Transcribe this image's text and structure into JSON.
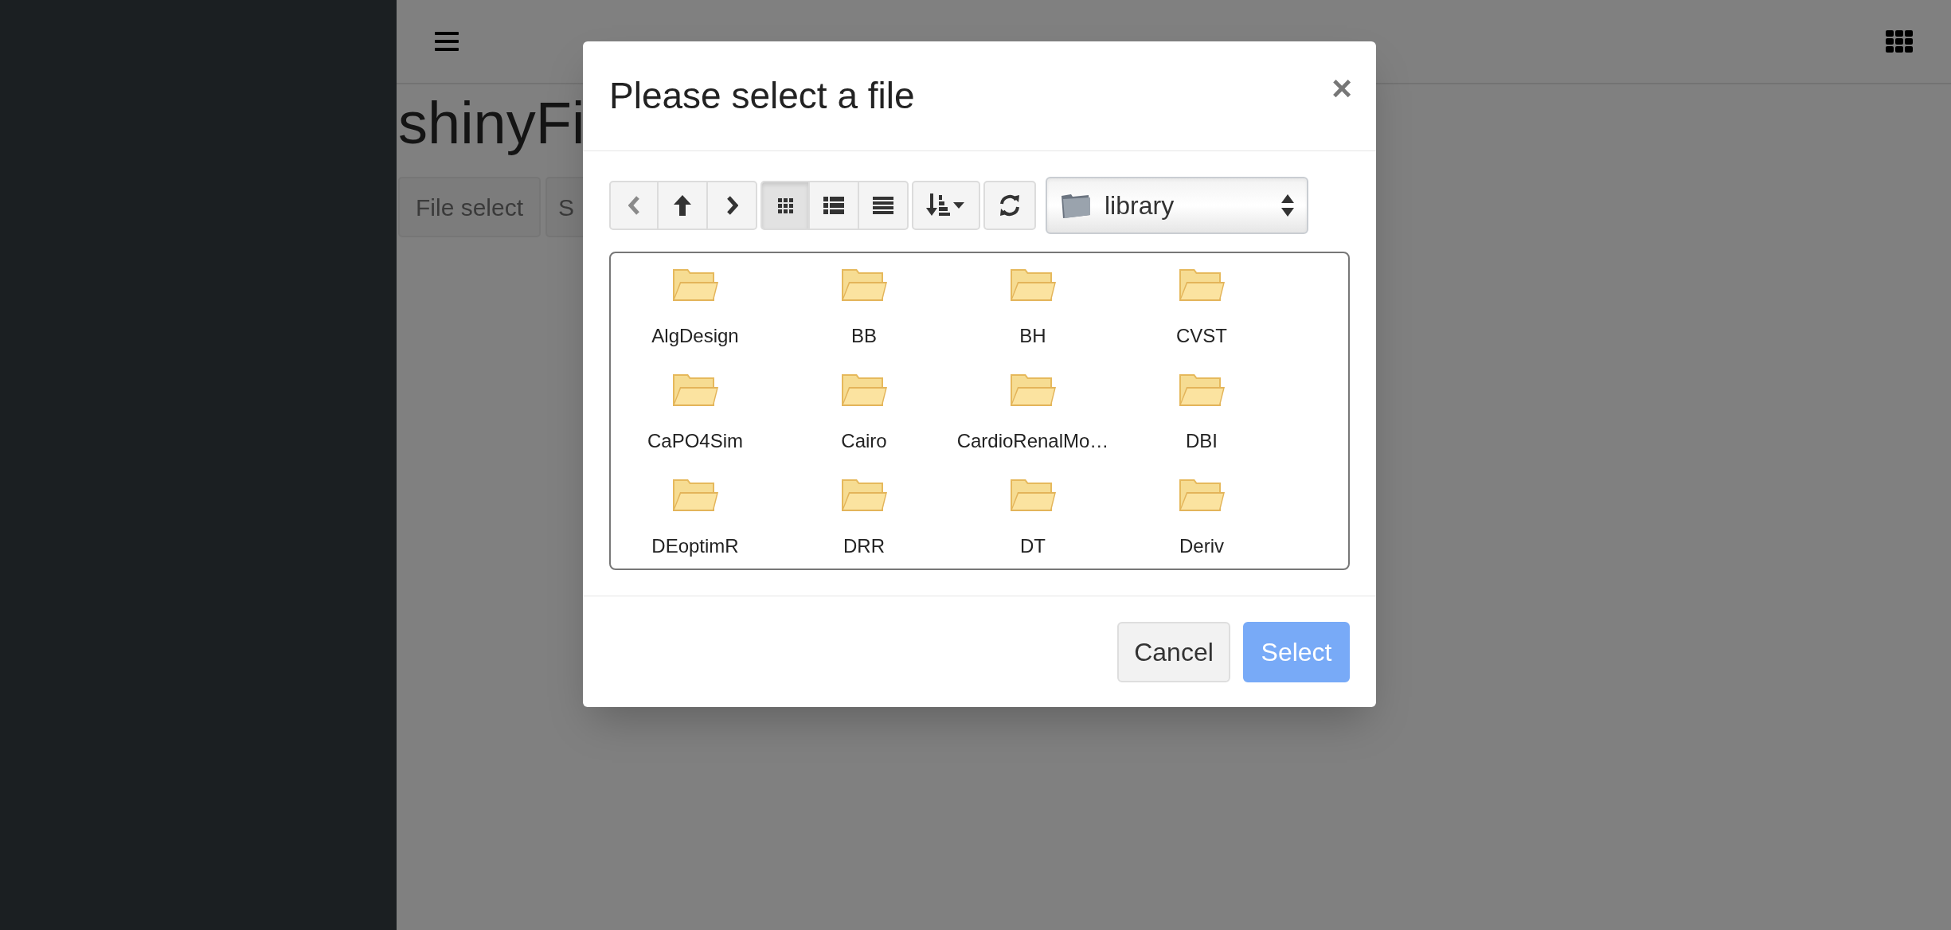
{
  "page": {
    "title": "shinyFi",
    "buttons": [
      {
        "label": "File select"
      },
      {
        "label": "S"
      }
    ]
  },
  "dialog": {
    "title": "Please select a file",
    "close": "×",
    "nav_buttons": [
      {
        "kind": "back",
        "disabled": true
      },
      {
        "kind": "up",
        "disabled": false
      },
      {
        "kind": "forward",
        "disabled": false
      }
    ],
    "view_buttons": [
      {
        "kind": "icons",
        "selected": true
      },
      {
        "kind": "list",
        "selected": false
      },
      {
        "kind": "detail",
        "selected": false
      }
    ],
    "folder_select": {
      "value": "library"
    },
    "folders": [
      {
        "name": "AlgDesign"
      },
      {
        "name": "BB"
      },
      {
        "name": "BH"
      },
      {
        "name": "CVST"
      },
      {
        "name": "CaPO4Sim"
      },
      {
        "name": "Cairo"
      },
      {
        "name": "CardioRenalMo…"
      },
      {
        "name": "DBI"
      },
      {
        "name": "DEoptimR"
      },
      {
        "name": "DRR"
      },
      {
        "name": "DT"
      },
      {
        "name": "Deriv"
      }
    ],
    "footer_buttons": [
      {
        "label": "Cancel",
        "kind": "default"
      },
      {
        "label": "Select",
        "kind": "primary"
      }
    ]
  }
}
